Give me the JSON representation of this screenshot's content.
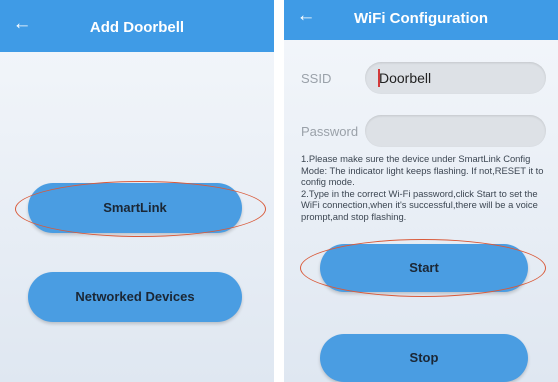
{
  "left_screen": {
    "title": "Add Doorbell",
    "smartlink_label": "SmartLink",
    "networked_label": "Networked Devices"
  },
  "right_screen": {
    "title": "WiFi Configuration",
    "ssid_label": "SSID",
    "ssid_value": "Doorbell",
    "password_label": "Password",
    "password_value": "",
    "info_text": "1.Please make sure the device under SmartLink Config Mode: The indicator light keeps flashing. If not,RESET it to config mode.\n2.Type in the correct Wi-Fi password,click Start to set the WiFi connection,when it's successful,there will be a voice prompt,and stop flashing.",
    "start_label": "Start",
    "stop_label": "Stop"
  },
  "icons": {
    "back": "back-arrow-icon"
  },
  "colors": {
    "header": "#3f9be6",
    "button": "#4a9de2",
    "highlight_ellipse": "#d95a3a"
  }
}
